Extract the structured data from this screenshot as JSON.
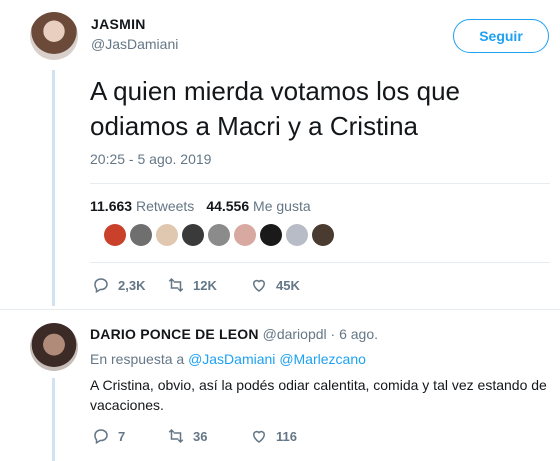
{
  "tweet": {
    "display_name": "JASMIN",
    "handle": "@JasDamiani",
    "follow_label": "Seguir",
    "text": "A quien mierda votamos los que odiamos a Macri y a Cristina",
    "timestamp": "20:25 - 5 ago. 2019",
    "retweets_count": "11.663",
    "retweets_label": "Retweets",
    "likes_count": "44.556",
    "likes_label": "Me gusta",
    "actions": {
      "replies": "2,3K",
      "retweets": "12K",
      "likes": "45K"
    }
  },
  "reply": {
    "display_name": "DARIO PONCE DE LEON",
    "handle": "@dariopdl",
    "separator": "·",
    "time": "6 ago.",
    "in_reply_prefix": "En respuesta a",
    "mention1": "@JasDamiani",
    "mention2": "@Marlezcano",
    "text": "A Cristina, obvio, así la podés odiar calentita, comida y tal vez estando de vacaciones.",
    "actions": {
      "replies": "7",
      "retweets": "36",
      "likes": "116"
    }
  },
  "colors": {
    "accent": "#1da1f2",
    "muted": "#657786",
    "text": "#14171a",
    "thread_line": "#cfe3f3",
    "likers": [
      "#c9412b",
      "#6f6f6f",
      "#e0c7b0",
      "#3a3a3a",
      "#8b8b8b",
      "#d8a9a0",
      "#1a1a1a",
      "#b8bcc6",
      "#4a3b30"
    ]
  },
  "icons": [
    "reply-icon",
    "retweet-icon",
    "heart-icon"
  ]
}
